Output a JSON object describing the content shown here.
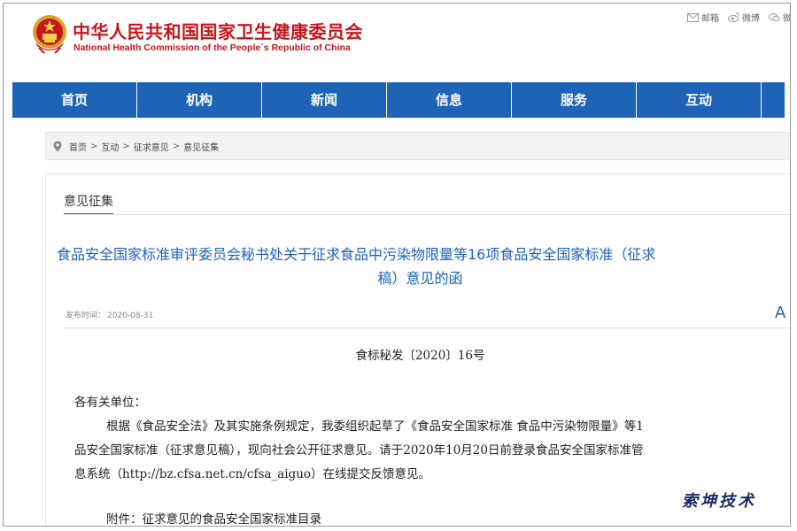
{
  "header": {
    "title_cn": "中华人民共和国国家卫生健康委员会",
    "title_en": "National Health Commission of the People´s Republic of China",
    "links": [
      {
        "icon": "mail-icon",
        "label": "邮箱"
      },
      {
        "icon": "weibo-icon",
        "label": "微博"
      },
      {
        "icon": "wechat-icon",
        "label": "微"
      }
    ]
  },
  "nav": {
    "items": [
      "首页",
      "机构",
      "新闻",
      "信息",
      "服务",
      "互动"
    ]
  },
  "breadcrumb": {
    "items": [
      "首页",
      "互动",
      "征求意见",
      "意见征集"
    ],
    "separator": ">"
  },
  "section": {
    "title": "意见征集"
  },
  "article": {
    "title_line1": "食品安全国家标准审评委员会秘书处关于征求食品中污染物限量等16项食品安全国家标准（征求",
    "title_line2": "稿）意见的函",
    "publish_label": "发布时间：",
    "publish_date": "2020-08-31",
    "font_size_control": "A",
    "doc_number": "食标秘发〔2020〕16号",
    "salutation": "各有关单位：",
    "para_line1": "根据《食品安全法》及其实施条例规定，我委组织起草了《食品安全国家标准 食品中污染物限量》等1",
    "para_line2": "品安全国家标准（征求意见稿），现向社会公开征求意见。请于2020年10月20日前登录食品安全国家标准管",
    "para_line3": "息系统（http://bz.cfsa.net.cn/cfsa_aiguo）在线提交反馈意见。",
    "attachment": "附件：征求意见的食品安全国家标准目录"
  },
  "watermark": "索坤技术",
  "colors": {
    "brand_red": "#c8161d",
    "nav_blue": "#1d63b6",
    "title_blue": "#1d63b6"
  }
}
